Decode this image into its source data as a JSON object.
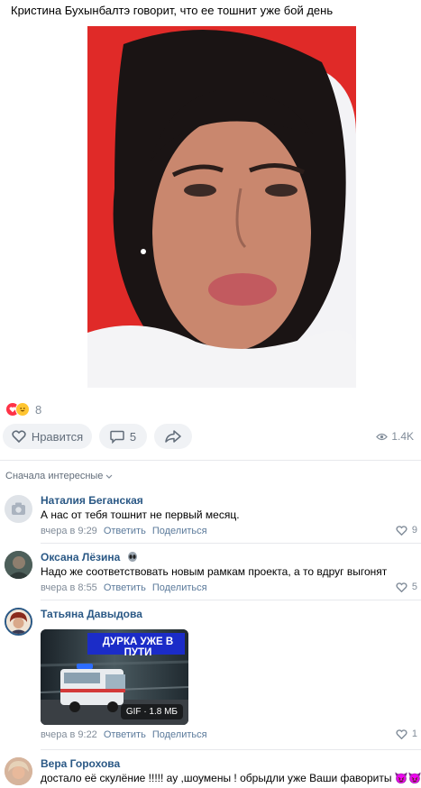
{
  "post": {
    "text": "Кристина Бухынбалтэ говорит, что ее тошнит уже бой день",
    "reactions_count": "8",
    "like_label": "Нравится",
    "comments_count": "5",
    "views": "1.4K"
  },
  "comments_header": {
    "sort_label": "Сначала интересные"
  },
  "comments": [
    {
      "author": "Наталия Беганская",
      "text": "А нас от тебя тошнит не первый месяц.",
      "time": "вчера в 9:29",
      "reply": "Ответить",
      "share": "Поделиться",
      "likes": "9"
    },
    {
      "author": "Оксана Лёзина",
      "text": "Надо же соответствовать новым рамкам проекта, а то вдруг выгонят",
      "time": "вчера в 8:55",
      "reply": "Ответить",
      "share": "Поделиться",
      "likes": "5"
    },
    {
      "author": "Татьяна Давыдова",
      "gif_caption": "ДУРКА УЖЕ В ПУТИ",
      "gif_badge": "GIF · 1.8 МБ",
      "time": "вчера в 9:22",
      "reply": "Ответить",
      "share": "Поделиться",
      "likes": "1"
    },
    {
      "author": "Вера Горохова",
      "text": "достало её скулёние !!!!! ау ,шоумены ! обрыдли уже Ваши фавориты 😈😈"
    }
  ],
  "colors": {
    "link": "#2a5885",
    "muted": "#818c99",
    "button_bg": "#f0f2f5",
    "photo_bg": "#e02a28"
  }
}
